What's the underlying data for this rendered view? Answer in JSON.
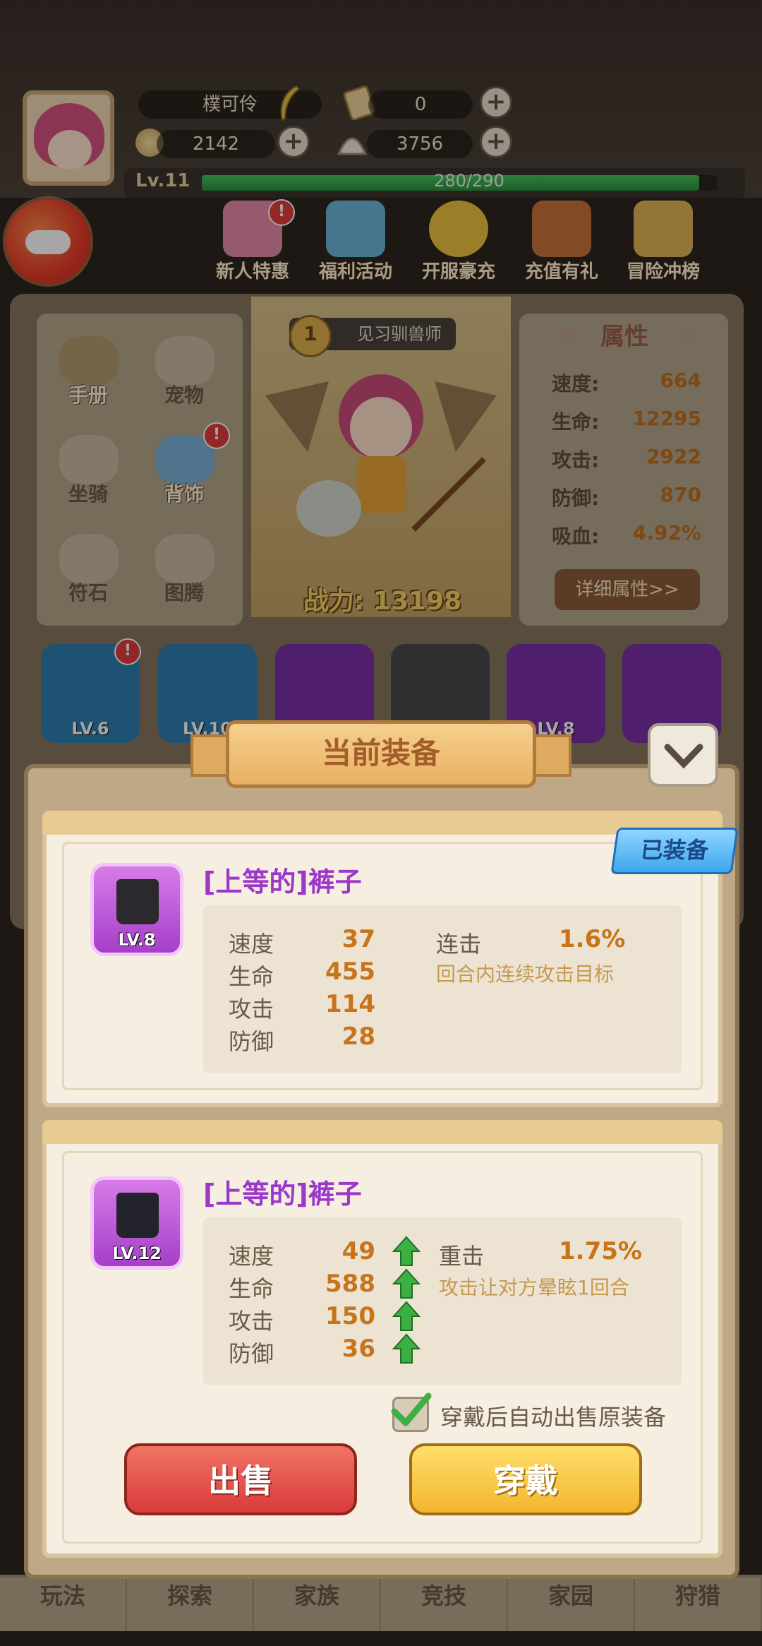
{
  "player": {
    "name": "樸可伶",
    "level": "Lv.11",
    "xp_text": "280/290",
    "xp_fraction": 0.966
  },
  "currencies": {
    "tickets": "0",
    "coins": "2142",
    "shells": "3756"
  },
  "events": [
    {
      "label": "新人特惠",
      "icon": "gift-girl-icon",
      "badge": "!"
    },
    {
      "label": "福利活动",
      "icon": "bag-icon"
    },
    {
      "label": "开服豪充",
      "icon": "trophy-icon"
    },
    {
      "label": "充值有礼",
      "icon": "chest-icon"
    },
    {
      "label": "冒险冲榜",
      "icon": "podium-icon"
    }
  ],
  "left_menu": [
    {
      "label": "手册",
      "icon": "book-icon",
      "active": true
    },
    {
      "label": "宠物",
      "icon": "pet-icon",
      "active": false
    },
    {
      "label": "坐骑",
      "icon": "mount-icon",
      "active": false
    },
    {
      "label": "背饰",
      "icon": "wing-icon",
      "active": true,
      "badge": "!"
    },
    {
      "label": "符石",
      "icon": "rune-icon",
      "active": false
    },
    {
      "label": "图腾",
      "icon": "totem-icon",
      "active": false
    }
  ],
  "hero": {
    "rank_no": "1",
    "rank_title": "见习驯兽师",
    "power": "战力: 13198"
  },
  "attributes": {
    "title": "属性",
    "rows": [
      {
        "k": "速度:",
        "v": "664"
      },
      {
        "k": "生命:",
        "v": "12295"
      },
      {
        "k": "攻击:",
        "v": "2922"
      },
      {
        "k": "防御:",
        "v": "870"
      },
      {
        "k": "吸血:",
        "v": "4.92%"
      }
    ],
    "detail_button": "详细属性>>"
  },
  "equip_row": [
    {
      "lv": "LV.6",
      "color": "#2f7fb0"
    },
    {
      "lv": "LV.10",
      "color": "#2f7fb0"
    },
    {
      "lv": "",
      "color": "#7a2fa6"
    },
    {
      "lv": "",
      "color": "#4a4a4e"
    },
    {
      "lv": "LV.8",
      "color": "#7a2fa6"
    },
    {
      "lv": "",
      "color": "#7a2fa6"
    }
  ],
  "modal": {
    "title": "当前装备",
    "equipped_badge": "已装备",
    "current": {
      "name": "[上等的]裤子",
      "level": "LV.8",
      "stats": [
        {
          "k": "速度",
          "v": "37"
        },
        {
          "k": "生命",
          "v": "455"
        },
        {
          "k": "攻击",
          "v": "114"
        },
        {
          "k": "防御",
          "v": "28"
        }
      ],
      "special": {
        "k": "连击",
        "v": "1.6%",
        "desc": "回合内连续攻击目标"
      }
    },
    "new": {
      "name": "[上等的]裤子",
      "level": "LV.12",
      "stats": [
        {
          "k": "速度",
          "v": "49"
        },
        {
          "k": "生命",
          "v": "588"
        },
        {
          "k": "攻击",
          "v": "150"
        },
        {
          "k": "防御",
          "v": "36"
        }
      ],
      "special": {
        "k": "重击",
        "v": "1.75%",
        "desc": "攻击让对方晕眩1回合"
      }
    },
    "auto_sell_label": "穿戴后自动出售原装备",
    "auto_sell_checked": true,
    "sell_button": "出售",
    "wear_button": "穿戴"
  },
  "tabs": [
    "玩法",
    "探索",
    "家族",
    "竞技",
    "家园",
    "狩猎"
  ],
  "colors": {
    "accent_purple": "#9b38c9",
    "value_orange": "#c7741a",
    "upgrade_green": "#3cb043"
  }
}
